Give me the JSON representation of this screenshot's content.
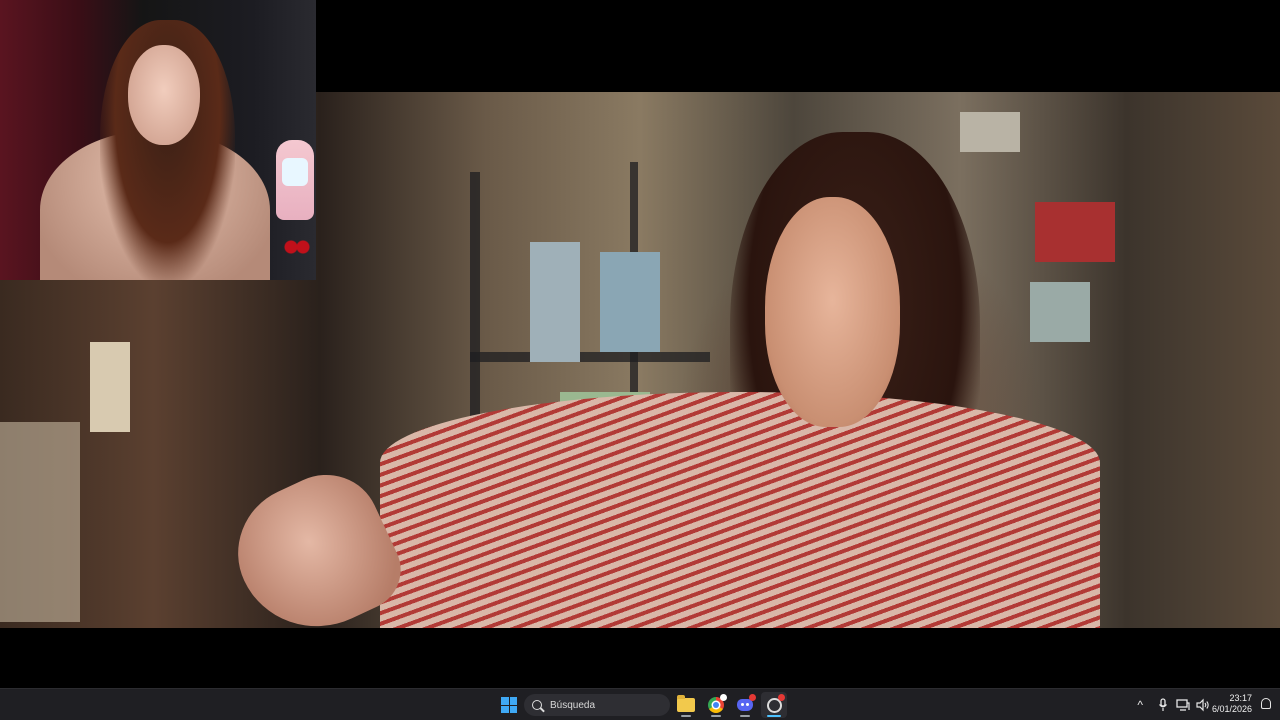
{
  "taskbar": {
    "search_placeholder": "Búsqueda",
    "apps": [
      {
        "name": "File Explorer",
        "icon": "folder-icon"
      },
      {
        "name": "Google Chrome",
        "icon": "chrome-icon"
      },
      {
        "name": "Discord",
        "icon": "discord-icon"
      },
      {
        "name": "OBS Studio",
        "icon": "obs-icon",
        "active": true
      }
    ],
    "badge_colors": {
      "chrome": "#ffffff",
      "discord": "#e53935",
      "obs": "#e53935"
    },
    "tray": {
      "chevron_glyph": "^",
      "time": "23:17",
      "date": "6/01/2026"
    }
  },
  "colors": {
    "taskbar_bg": "#1f1f23",
    "accent": "#4cc2ff"
  }
}
